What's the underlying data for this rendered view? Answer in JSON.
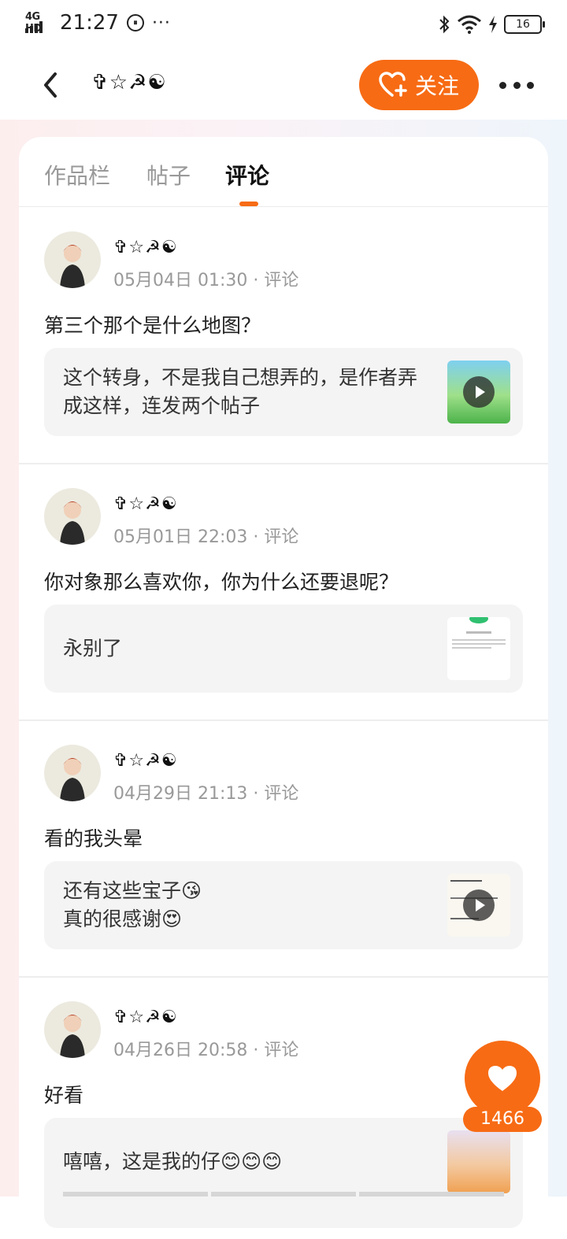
{
  "status_bar": {
    "network": "4G HD",
    "time": "21:27",
    "notif_icon": "flow-icon",
    "dots": "···",
    "battery": "16"
  },
  "header": {
    "title": "✞☆☭☯",
    "follow_label": "关注"
  },
  "tabs": [
    {
      "label": "作品栏"
    },
    {
      "label": "帖子"
    },
    {
      "label": "评论"
    }
  ],
  "comments": [
    {
      "name": "✞☆☭☯",
      "meta": "05月04日 01:30 · 评论",
      "text": "第三个那个是什么地图？",
      "quote": "这个转身，不是我自己想弄的，是作者弄成这样，连发两个帖子",
      "thumb": "video"
    },
    {
      "name": "✞☆☭☯",
      "meta": "05月01日 22:03 · 评论",
      "text": "你对象那么喜欢你，你为什么还要退呢？",
      "quote": "永别了",
      "thumb": "image"
    },
    {
      "name": "✞☆☭☯",
      "meta": "04月29日 21:13 · 评论",
      "text": "看的我头晕",
      "quote_line1": "还有这些宝子😘",
      "quote_line2": "真的很感谢😍",
      "thumb": "video"
    },
    {
      "name": "✞☆☭☯",
      "meta": "04月26日 20:58 · 评论",
      "text": "好看",
      "quote": "嘻嘻，这是我的仔😊😊😊",
      "thumb": "image"
    }
  ],
  "like_count": "1466",
  "colors": {
    "accent": "#f76b14"
  }
}
